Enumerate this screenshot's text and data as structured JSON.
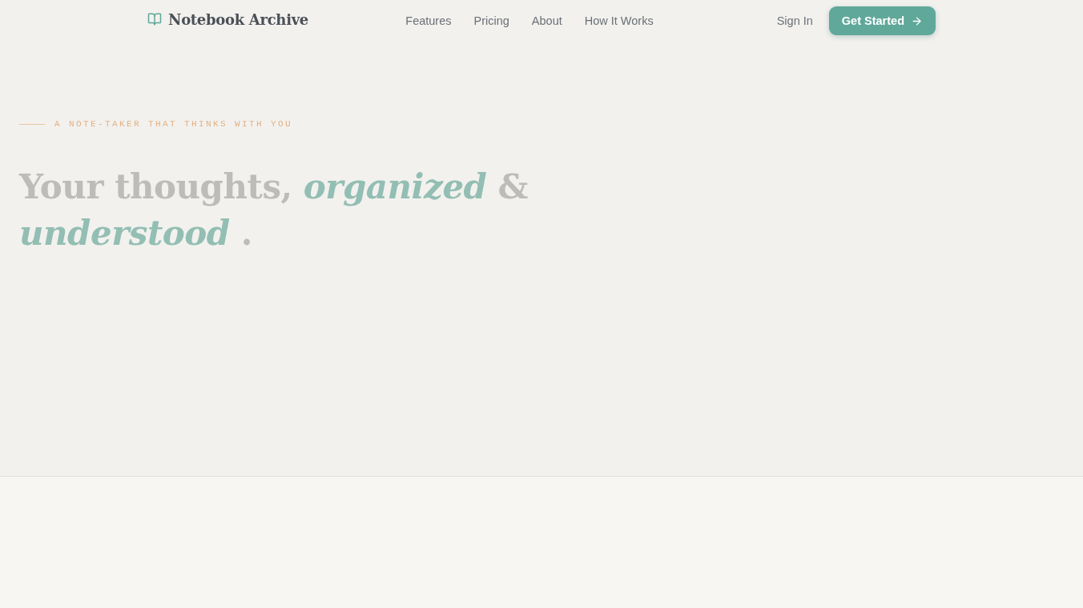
{
  "nav": {
    "logo": "Notebook Archive",
    "links": [
      "Features",
      "Pricing",
      "About",
      "How It Works"
    ],
    "sign_in": "Sign In",
    "cta": "Get Started"
  },
  "hero": {
    "tagline": "A NOTE-TAKER THAT THINKS WITH YOU",
    "headline": "Your thoughts, *organized* & *understood* ."
  }
}
